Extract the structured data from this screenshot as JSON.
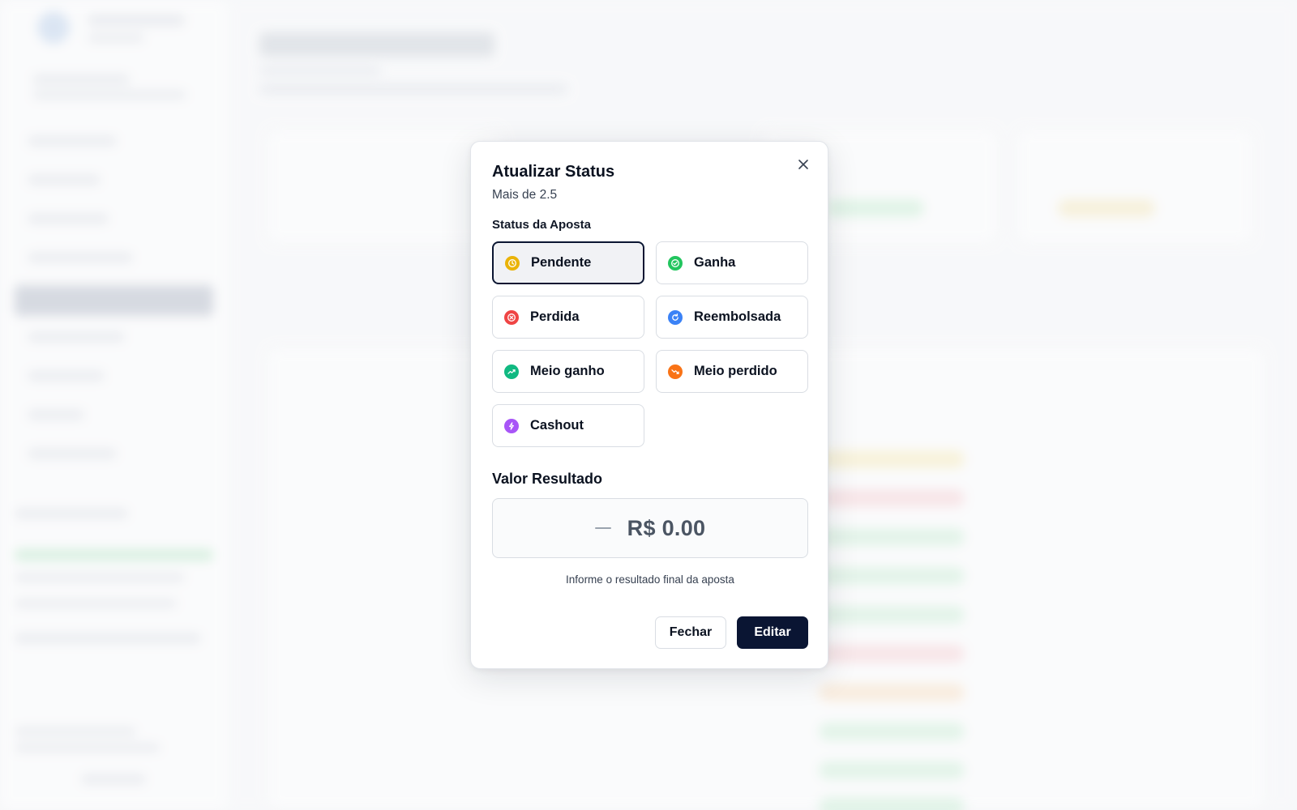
{
  "modal": {
    "title": "Atualizar Status",
    "subtitle": "Mais de 2.5",
    "status_label": "Status da Aposta",
    "statuses": [
      {
        "label": "Pendente",
        "icon": "clock-icon",
        "color": "#eab308",
        "selected": true
      },
      {
        "label": "Ganha",
        "icon": "check-circle-icon",
        "color": "#22c55e",
        "selected": false
      },
      {
        "label": "Perdida",
        "icon": "x-circle-icon",
        "color": "#ef4444",
        "selected": false
      },
      {
        "label": "Reembolsada",
        "icon": "refresh-icon",
        "color": "#3b82f6",
        "selected": false
      },
      {
        "label": "Meio ganho",
        "icon": "trending-up-icon",
        "color": "#10b981",
        "selected": false
      },
      {
        "label": "Meio perdido",
        "icon": "trending-down-icon",
        "color": "#f97316",
        "selected": false
      },
      {
        "label": "Cashout",
        "icon": "bolt-icon",
        "color": "#a855f7",
        "selected": false
      }
    ],
    "value_label": "Valor Resultado",
    "value": "R$ 0.00",
    "value_help": "Informe o resultado final da aposta",
    "close_button": "Fechar",
    "edit_button": "Editar"
  }
}
